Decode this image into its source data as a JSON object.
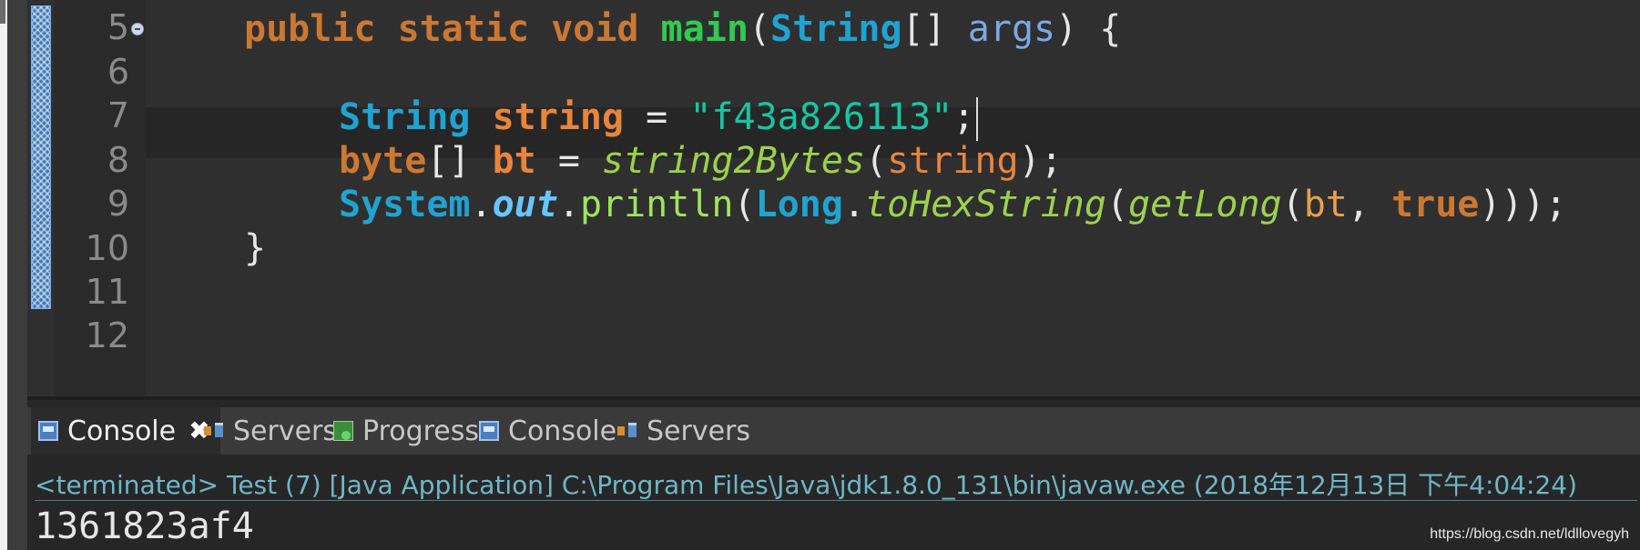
{
  "editor": {
    "line_numbers": [
      "5",
      "6",
      "7",
      "8",
      "9",
      "10",
      "11",
      "12"
    ],
    "code": {
      "l5": {
        "kw1": "public",
        "kw2": "static",
        "kw3": "void",
        "method": "main",
        "open": "(",
        "type": "String",
        "arr": "[] ",
        "param": "args",
        "close": ") {"
      },
      "l7": {
        "type": "String",
        "var": "string",
        "eq": " = ",
        "str": "\"f43a826113\"",
        "semi": ";"
      },
      "l8": {
        "kw": "byte",
        "arr": "[] ",
        "var": "bt",
        "eq": " = ",
        "call": "string2Bytes",
        "open": "(",
        "arg": "string",
        "close": ");"
      },
      "l9": {
        "type1": "System",
        "dot1": ".",
        "field": "out",
        "dot2": ".",
        "call": "println",
        "open1": "(",
        "type2": "Long",
        "dot3": ".",
        "m1": "toHexString",
        "open2": "(",
        "m2": "getLong",
        "open3": "(",
        "arg": "bt",
        "comma": ", ",
        "kw": "true",
        "close": ")));"
      },
      "l10": {
        "brace": "}"
      }
    }
  },
  "console": {
    "tabs": [
      {
        "label": "Console",
        "icon": "console-icon",
        "active": true,
        "closable": true
      },
      {
        "label": "Servers",
        "icon": "servers-icon",
        "active": false
      },
      {
        "label": "Progress",
        "icon": "progress-icon",
        "active": false
      },
      {
        "label": "Console",
        "icon": "console-icon",
        "active": false
      },
      {
        "label": "Servers",
        "icon": "servers-icon",
        "active": false
      }
    ],
    "close_glyph": "✖",
    "status": "<terminated> Test (7) [Java Application] C:\\Program Files\\Java\\jdk1.8.0_131\\bin\\javaw.exe (2018年12月13日 下午4:04:24)",
    "output": "1361823af4"
  },
  "watermark": "https://blog.csdn.net/ldllovegyh",
  "colors": {
    "keyword": "#cc7832",
    "type": "#1fa3d1",
    "method": "#2ecc4f",
    "string": "#17c6a3",
    "background": "#2b2b2b"
  }
}
